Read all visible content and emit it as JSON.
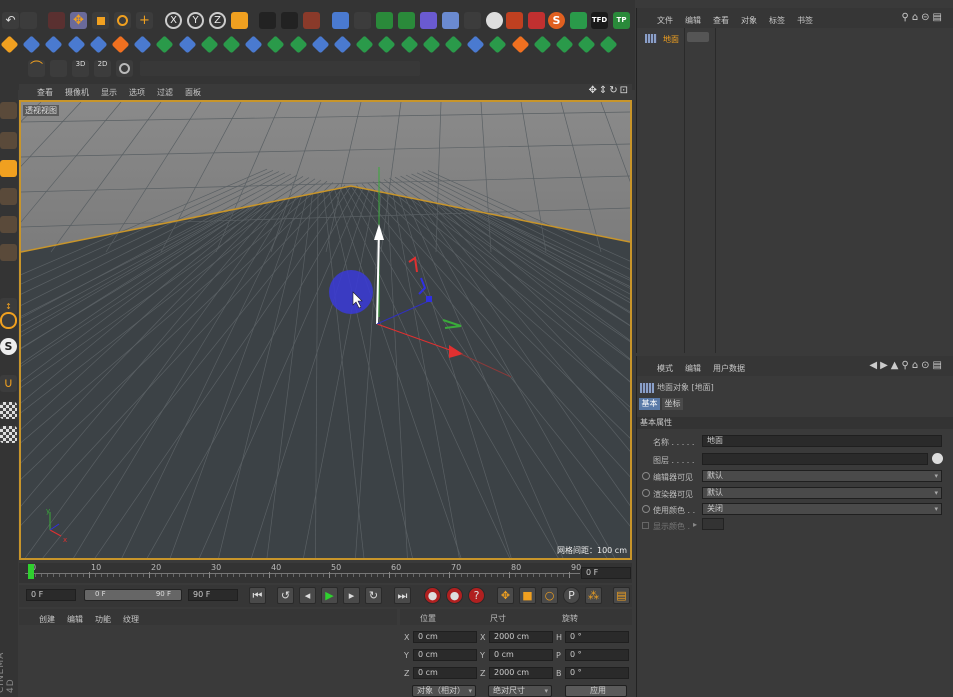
{
  "viewport": {
    "menu": [
      "查看",
      "摄像机",
      "显示",
      "选项",
      "过滤",
      "面板"
    ],
    "label": "透视视图",
    "grid_info": "网格间距：100 cm"
  },
  "objects_panel": {
    "menu": [
      "文件",
      "编辑",
      "查看",
      "对象",
      "标签",
      "书签"
    ],
    "item_name": "地面"
  },
  "attributes_panel": {
    "menu": [
      "模式",
      "编辑",
      "用户数据"
    ],
    "object_title": "地面对象 [地面]",
    "tabs": [
      "基本",
      "坐标"
    ],
    "section": "基本属性",
    "fields": [
      {
        "label": "名称 . . . . .",
        "value": "地面"
      },
      {
        "label": "图层 . . . . .",
        "value": ""
      },
      {
        "label": "编辑器可见",
        "value": "默认"
      },
      {
        "label": "渲染器可见",
        "value": "默认"
      },
      {
        "label": "使用颜色 . .",
        "value": "关闭"
      },
      {
        "label": "显示颜色 .",
        "value": ""
      }
    ]
  },
  "timeline": {
    "ticks": [
      "0",
      "10",
      "20",
      "30",
      "40",
      "50",
      "60",
      "70",
      "80",
      "90"
    ],
    "frame_end_field": "0 F",
    "start": "0 F",
    "range_start": "0 F",
    "range_end": "90 F",
    "end": "90 F"
  },
  "material_menu": [
    "创建",
    "编辑",
    "功能",
    "纹理"
  ],
  "coords": {
    "headers": [
      "位置",
      "尺寸",
      "旋转"
    ],
    "rows": [
      {
        "axis": "X",
        "pos": "0 cm",
        "size_axis": "X",
        "size": "2000 cm",
        "rot_axis": "H",
        "rot": "0 °"
      },
      {
        "axis": "Y",
        "pos": "0 cm",
        "size_axis": "Y",
        "size": "0 cm",
        "rot_axis": "P",
        "rot": "0 °"
      },
      {
        "axis": "Z",
        "pos": "0 cm",
        "size_axis": "Z",
        "size": "2000 cm",
        "rot_axis": "B",
        "rot": "0 °"
      }
    ],
    "mode1": "对象（相对）",
    "mode2": "绝对尺寸",
    "apply": "应用"
  },
  "brand": "CINEMA 4D",
  "toolbar": {
    "tfd": "TFD",
    "tp": "TP",
    "s": "S"
  },
  "colors": {
    "accent": "#f0a020",
    "selection_blue": "#3a3ad8",
    "timeline_green": "#2fd02f"
  }
}
